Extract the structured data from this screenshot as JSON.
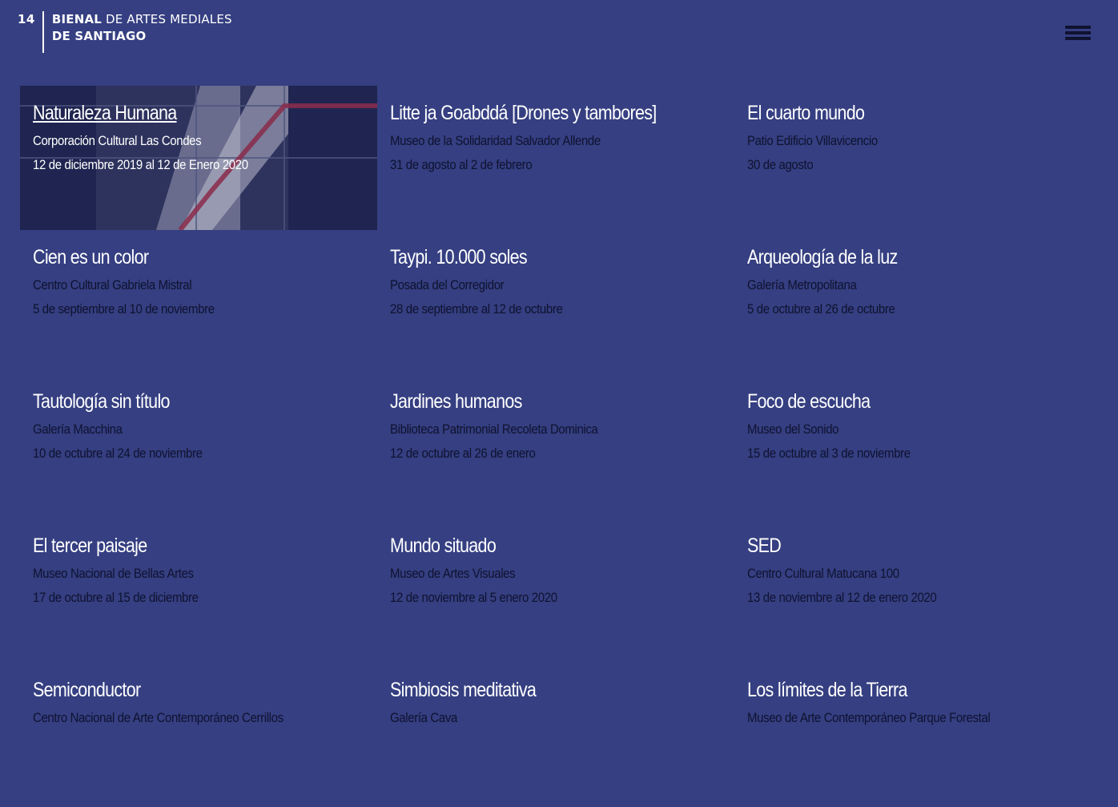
{
  "header": {
    "edition": "14",
    "brand_bold": "BIENAL",
    "brand_rest": " DE ARTES MEDIALES",
    "brand_line2": "DE SANTIAGO",
    "menu_icon": "hamburger-menu-icon"
  },
  "exhibitions": [
    {
      "title": "Naturaleza Humana",
      "venue": "Corporación Cultural Las Condes",
      "dates": "12 de diciembre 2019 al 12 de Enero 2020"
    },
    {
      "title": "Litte ja Goabddá [Drones y tambores]",
      "venue": "Museo de la Solidaridad Salvador Allende",
      "dates": "31 de agosto al 2 de febrero"
    },
    {
      "title": "El cuarto mundo",
      "venue": "Patio Edificio Villavicencio",
      "dates": "30 de agosto"
    },
    {
      "title": "Cien es un color",
      "venue": "Centro Cultural Gabriela Mistral",
      "dates": "5 de septiembre al 10 de noviembre"
    },
    {
      "title": "Taypi. 10.000 soles",
      "venue": "Posada del Corregidor",
      "dates": "28 de septiembre al 12 de octubre"
    },
    {
      "title": "Arqueología de la luz",
      "venue": "Galería Metropolitana",
      "dates": "5 de octubre al 26 de octubre"
    },
    {
      "title": "Tautología sin título",
      "venue": "Galería Macchina",
      "dates": "10 de octubre al 24 de noviembre"
    },
    {
      "title": "Jardines humanos",
      "venue": "Biblioteca Patrimonial Recoleta Dominica",
      "dates": "12 de octubre al 26 de enero"
    },
    {
      "title": "Foco de escucha",
      "venue": "Museo del Sonido",
      "dates": "15 de octubre al 3 de noviembre"
    },
    {
      "title": "El tercer paisaje",
      "venue": "Museo Nacional de Bellas Artes",
      "dates": "17 de octubre al 15 de diciembre"
    },
    {
      "title": "Mundo situado",
      "venue": "Museo de Artes Visuales",
      "dates": "12 de noviembre al 5 enero 2020"
    },
    {
      "title": "SED",
      "venue": "Centro Cultural Matucana 100",
      "dates": "13 de noviembre al 12 de enero 2020"
    },
    {
      "title": "Semiconductor",
      "venue": "Centro Nacional de Arte Contemporáneo Cerrillos",
      "dates": ""
    },
    {
      "title": "Simbiosis meditativa",
      "venue": "Galería Cava",
      "dates": ""
    },
    {
      "title": "Los límites de la Tierra",
      "venue": "Museo de Arte Contemporáneo Parque Forestal",
      "dates": ""
    }
  ],
  "colors": {
    "background": "#353f81",
    "active_card": "#1f2550",
    "secondary_text": "#0f1230",
    "primary_text": "#ffffff"
  }
}
